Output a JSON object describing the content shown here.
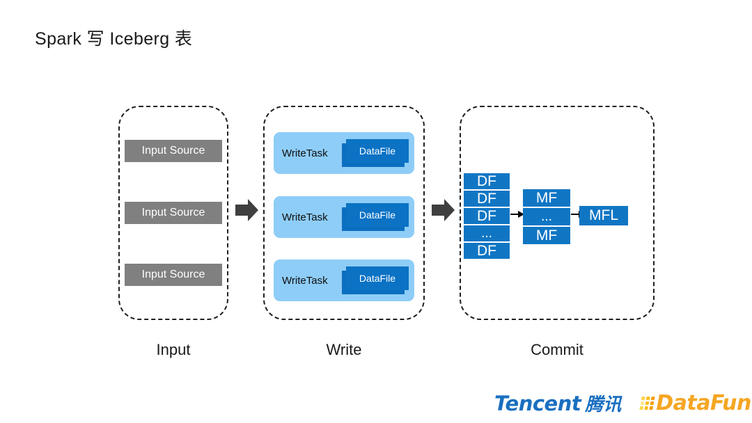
{
  "slide": {
    "title": "Spark 写 Iceberg 表",
    "background_color": "#ffffff"
  },
  "colors": {
    "input_source_gray": "#808080",
    "write_task_light_blue": "#8ecdf7",
    "datafile_blue": "#0b72c4",
    "commit_cell_blue": "#1076c4",
    "arrow_dark_gray": "#3f3f3f",
    "dashed_border": "#1f1f1f",
    "tencent_blue": "#1a6fc0",
    "datafun_orange": "#f5a623",
    "datafun_deep_orange": "#f26522"
  },
  "stages": {
    "input": {
      "label": "Input",
      "sources": [
        {
          "label": "Input Source"
        },
        {
          "label": "Input Source"
        },
        {
          "label": "Input Source"
        }
      ]
    },
    "write": {
      "label": "Write",
      "tasks": [
        {
          "task_label": "WriteTask",
          "file_label": "DataFile"
        },
        {
          "task_label": "WriteTask",
          "file_label": "DataFile"
        },
        {
          "task_label": "WriteTask",
          "file_label": "DataFile"
        }
      ]
    },
    "commit": {
      "label": "Commit",
      "data_file_stack": [
        "DF",
        "DF",
        "DF",
        "...",
        "DF"
      ],
      "manifest_file_stack": [
        "MF",
        "...",
        "MF"
      ],
      "manifest_list": "MFL"
    }
  },
  "arrows": {
    "input_to_write": "block-arrow-right",
    "write_to_commit": "block-arrow-right",
    "df_to_mf": "thin-arrow-right",
    "mf_to_mfl": "thin-arrow-right"
  },
  "footer": {
    "tencent": {
      "word": "Tencent",
      "cn": "腾讯"
    },
    "datafun": {
      "word": "DataFun",
      "tail": "."
    }
  }
}
